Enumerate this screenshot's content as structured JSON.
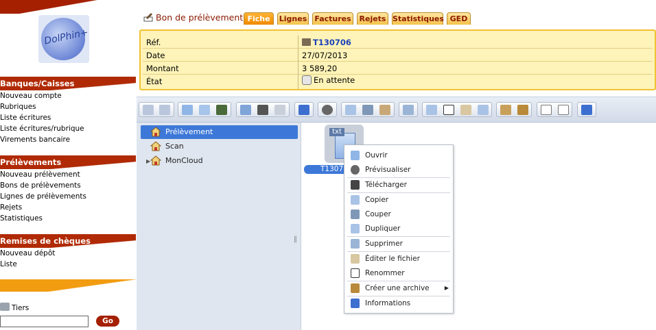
{
  "logo_text": "DolPhin+",
  "sidebar": {
    "sections": [
      {
        "title": "Banques/Caisses",
        "items": [
          "Nouveau compte",
          "Rubriques",
          "Liste écritures",
          "Liste écritures/rubrique",
          "Virements bancaire"
        ]
      },
      {
        "title": "Prélèvements",
        "items": [
          "Nouveau prélèvement",
          "Bons de prélèvements",
          "Lignes de prélèvements",
          "Rejets",
          "Statistiques"
        ]
      },
      {
        "title": "Remises de chèques",
        "items": [
          "Nouveau dépôt",
          "Liste"
        ]
      }
    ],
    "tiers_label": "Tiers",
    "tiers_value": "",
    "go_label": "Go"
  },
  "header": {
    "title": "Bon de prélèvement",
    "tabs": [
      {
        "label": "Fiche",
        "active": true
      },
      {
        "label": "Lignes",
        "active": false
      },
      {
        "label": "Factures",
        "active": false
      },
      {
        "label": "Rejets",
        "active": false
      },
      {
        "label": "Statistiques",
        "active": false
      },
      {
        "label": "GED",
        "active": false
      }
    ]
  },
  "record": {
    "ref_label": "Réf.",
    "ref_value": "T130706",
    "date_label": "Date",
    "date_value": "27/07/2013",
    "montant_label": "Montant",
    "montant_value": "3 589,20",
    "etat_label": "État",
    "etat_value": "En attente"
  },
  "file_manager": {
    "tree": [
      {
        "label": "Prélèvement",
        "selected": true
      },
      {
        "label": "Scan",
        "selected": false
      },
      {
        "label": "MonCloud",
        "selected": false
      }
    ],
    "file": {
      "badge": "txt",
      "name": "T1307"
    },
    "context_menu": [
      "Ouvrir",
      "Prévisualiser",
      "Télécharger",
      "Copier",
      "Couper",
      "Dupliquer",
      "Supprimer",
      "Éditer le fichier",
      "Renommer",
      "Créer une archive",
      "Informations"
    ]
  },
  "colors": {
    "brand_red": "#a52000",
    "accent_orange": "#f08a00",
    "selection_blue": "#3d78d8",
    "info_bg": "#fef3b8"
  }
}
